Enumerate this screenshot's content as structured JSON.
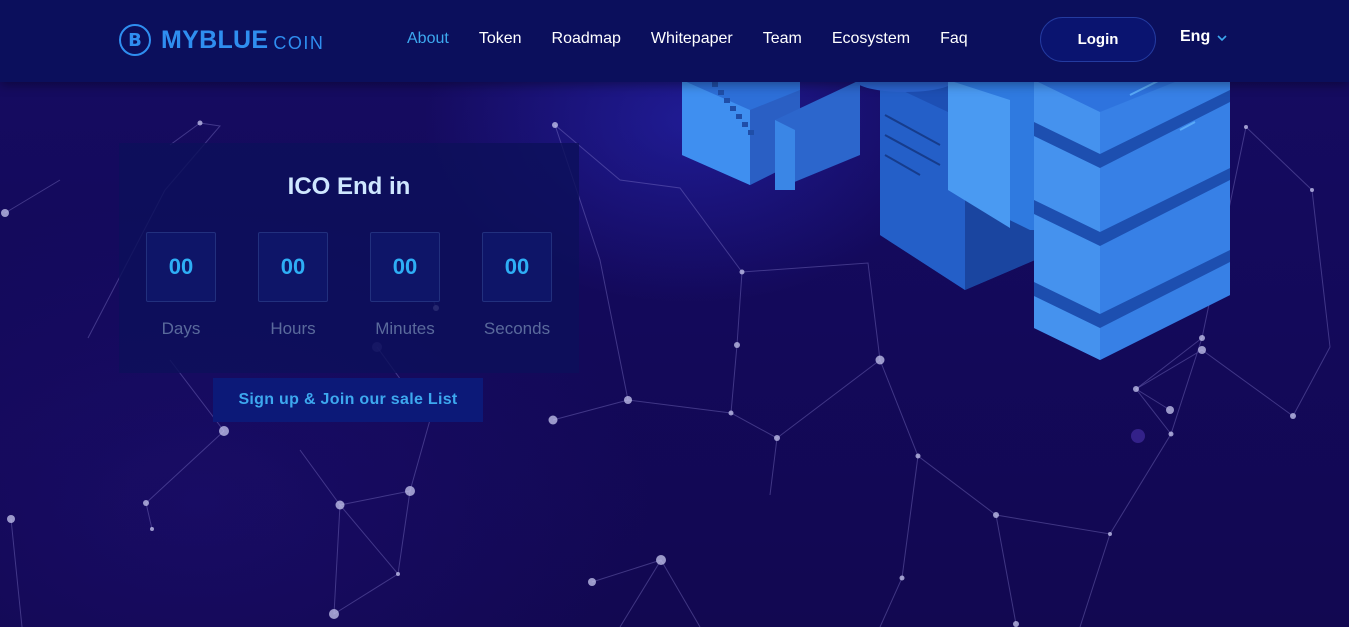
{
  "brand": {
    "icon_letter": "B",
    "name": "MYBLUE",
    "suffix": "COIN"
  },
  "nav": {
    "items": [
      {
        "label": "About",
        "active": true
      },
      {
        "label": "Token",
        "active": false
      },
      {
        "label": "Roadmap",
        "active": false
      },
      {
        "label": "Whitepaper",
        "active": false
      },
      {
        "label": "Team",
        "active": false
      },
      {
        "label": "Ecosystem",
        "active": false
      },
      {
        "label": "Faq",
        "active": false
      }
    ],
    "login_label": "Login",
    "language": "Eng"
  },
  "countdown": {
    "title": "ICO End in",
    "units": [
      {
        "value": "00",
        "label": "Days"
      },
      {
        "value": "00",
        "label": "Hours"
      },
      {
        "value": "00",
        "label": "Minutes"
      },
      {
        "value": "00",
        "label": "Seconds"
      }
    ],
    "signup_label": "Sign up & Join our sale List"
  },
  "colors": {
    "accent": "#3da8ef",
    "header_bg": "#0b0f5c",
    "page_bg": "#130a52",
    "server_blue": "#3a86e6"
  },
  "icons": {
    "language_dropdown": "chevron-down-icon",
    "logo": "coin-logo-icon"
  }
}
